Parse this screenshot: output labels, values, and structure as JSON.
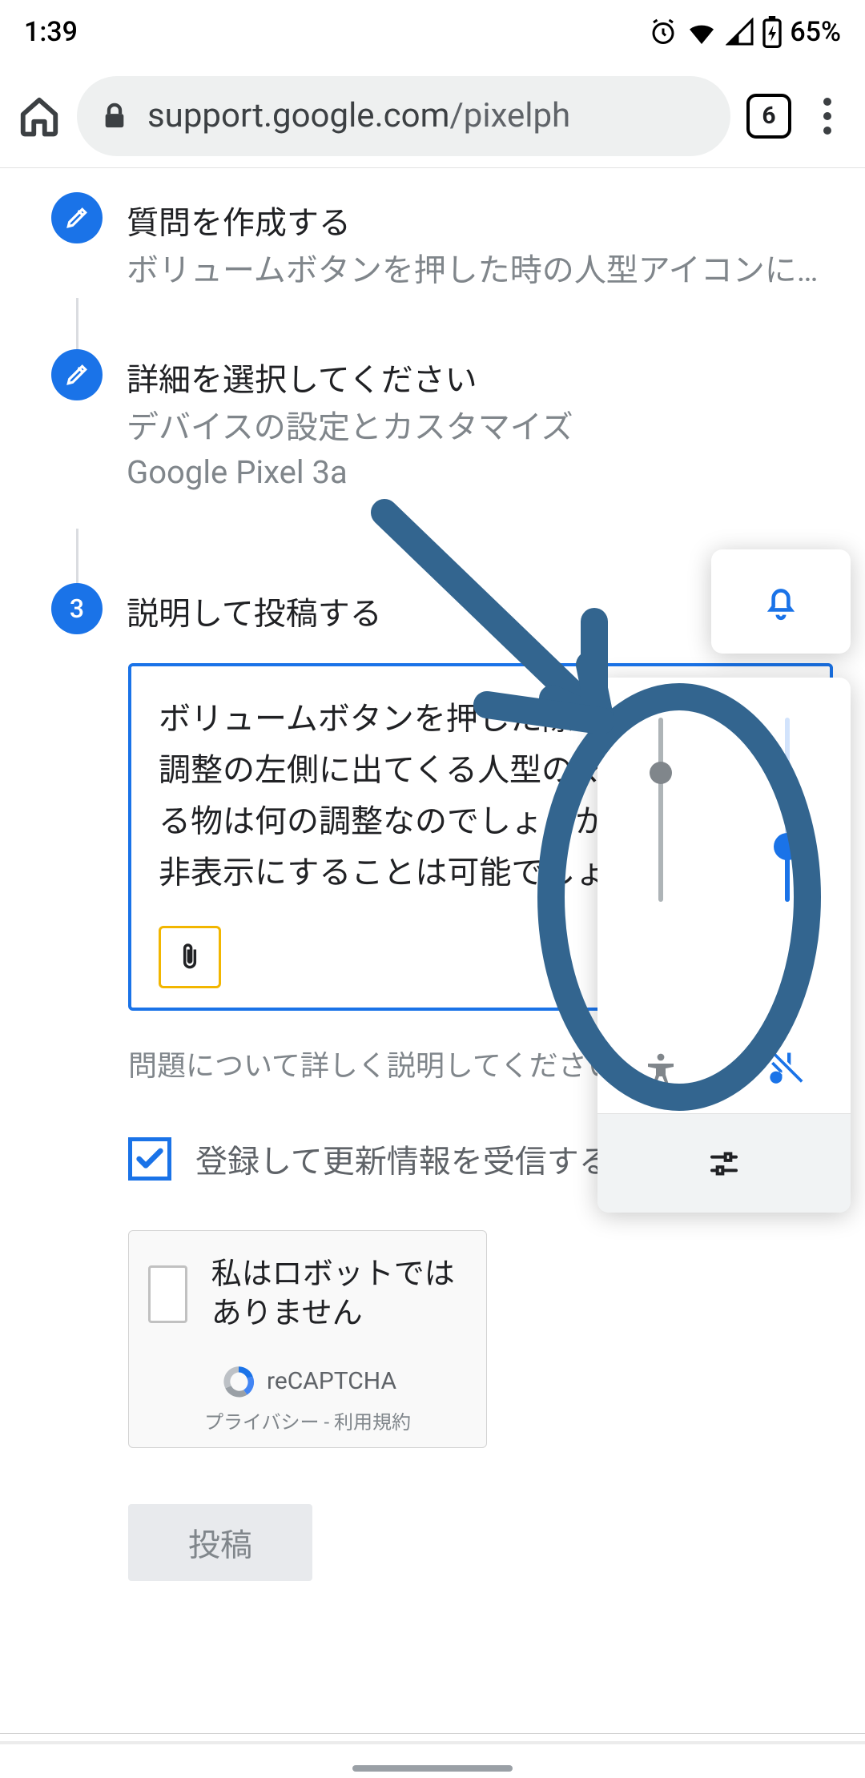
{
  "status": {
    "time": "1:39",
    "battery": "65%",
    "tab_count": "6"
  },
  "omnibox": {
    "host": "support.google.com",
    "path": "/pixelph"
  },
  "steps": {
    "s1": {
      "title": "質問を作成する",
      "sub": "ボリュームボタンを押した時の人型アイコンに…"
    },
    "s2": {
      "title": "詳細を選択してください",
      "sub1": "デバイスの設定とカスタマイズ",
      "sub2": "Google Pixel 3a"
    },
    "s3": {
      "number": "3",
      "title": "説明して投稿する"
    }
  },
  "textarea": {
    "value": "ボリュームボタンを押した際、メディア音量調整の左側に出てくる人型のマークで表される物は何の調整なのでしょうか。またそれは非表示にすることは可能でしょうか？"
  },
  "helper": "問題について詳しく説明してください。",
  "checkbox": {
    "label": "登録して更新情報を受信する",
    "checked": true
  },
  "recaptcha": {
    "label": "私はロボットではありません",
    "brand": "reCAPTCHA",
    "links": "プライバシー - 利用規約"
  },
  "submit": {
    "label": "投稿"
  }
}
